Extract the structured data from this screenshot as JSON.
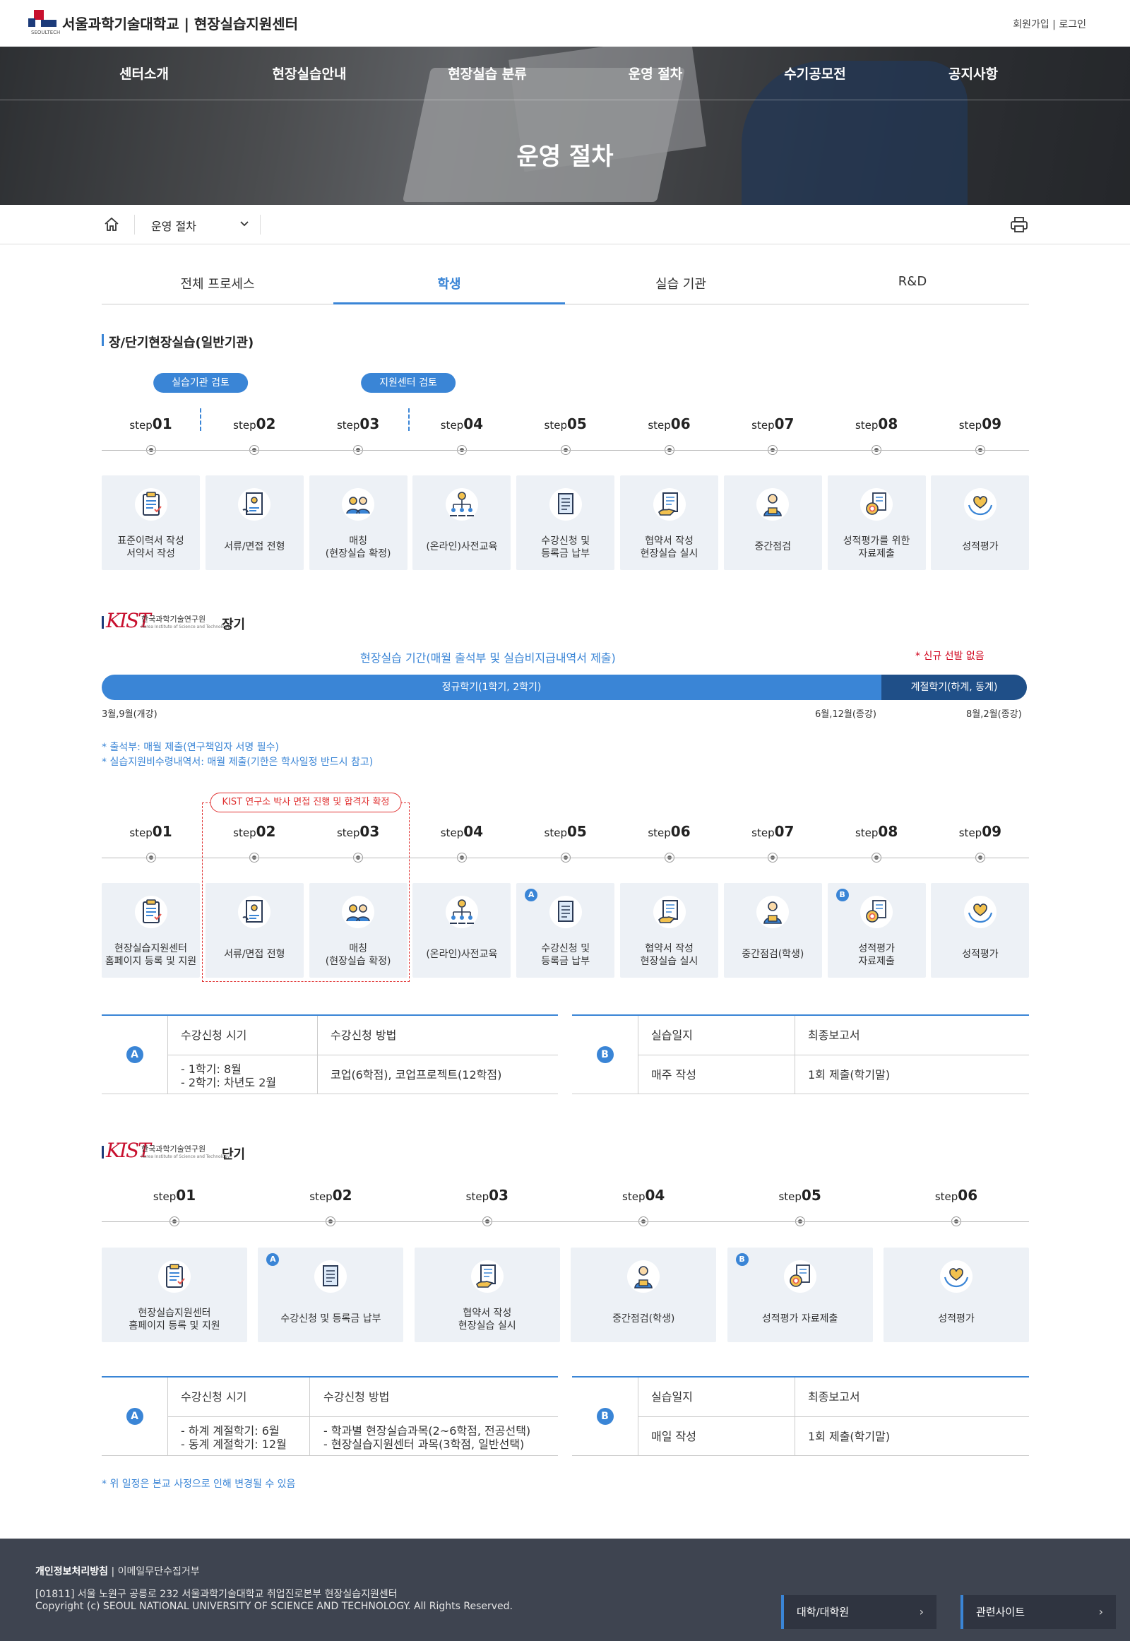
{
  "header": {
    "brand": "서울과학기술대학교 | 현장실습지원센터",
    "logo_sub": "SEOULTECH",
    "signup": "회원가입",
    "sep": " | ",
    "login": "로그인"
  },
  "nav": [
    "센터소개",
    "현장실습안내",
    "현장실습 분류",
    "운영 절차",
    "수기공모전",
    "공지사항"
  ],
  "hero_title": "운영 절차",
  "breadcrumb": {
    "selected": "운영 절차"
  },
  "tabs": [
    "전체 프로세스",
    "학생",
    "실습 기관",
    "R&D"
  ],
  "section1": {
    "title": "장/단기현장실습(일반기관)",
    "pill1": "실습기관 검토",
    "pill2": "지원센터 검토",
    "steps": [
      {
        "w": "step",
        "n": "01"
      },
      {
        "w": "step",
        "n": "02"
      },
      {
        "w": "step",
        "n": "03"
      },
      {
        "w": "step",
        "n": "04"
      },
      {
        "w": "step",
        "n": "05"
      },
      {
        "w": "step",
        "n": "06"
      },
      {
        "w": "step",
        "n": "07"
      },
      {
        "w": "step",
        "n": "08"
      },
      {
        "w": "step",
        "n": "09"
      }
    ],
    "cards": [
      [
        "표준이력서 작성",
        "서약서 작성"
      ],
      [
        "서류/면접 전형"
      ],
      [
        "매칭",
        "(현장실습 확정)"
      ],
      [
        "(온라인)사전교육"
      ],
      [
        "수강신청 및",
        "등록금 납부"
      ],
      [
        "협약서 작성",
        "현장실습 실시"
      ],
      [
        "중간점검"
      ],
      [
        "성적평가를 위한",
        "자료제출"
      ],
      [
        "성적평가"
      ]
    ]
  },
  "section2": {
    "kist_name": "한국과학기술연구원",
    "kist_eng": "Korea Institute of Science and Technology",
    "type": "장기",
    "period": "현장실습 기간(매월 출석부 및 실습비지급내역서 제출)",
    "no_select": "* 신규 선발 없음",
    "bar_regular": "정규학기(1학기, 2학기)",
    "bar_season": "계절학기(하계, 동계)",
    "date1": "3월,9월(개강)",
    "date2": "6월,12월(종강)",
    "date3": "8월,2월(종강)",
    "note1": "* 출석부: 매월 제출(연구책임자 서명 필수)",
    "note2": "* 실습지원비수령내역서: 매월 제출(기한은 학사일정 반드시 참고)",
    "red_pill": "KIST 연구소 박사 면접 진행 및 합격자 확정",
    "cards": [
      [
        "현장실습지원센터",
        "홈페이지 등록 및 지원"
      ],
      [
        "서류/면접 전형"
      ],
      [
        "매칭",
        "(현장실습 확정)"
      ],
      [
        "(온라인)사전교육"
      ],
      [
        "수강신청 및",
        "등록금 납부"
      ],
      [
        "협약서 작성",
        "현장실습 실시"
      ],
      [
        "중간점검(학생)"
      ],
      [
        "성적평가",
        "자료제출"
      ],
      [
        "성적평가"
      ]
    ],
    "badgeA": "A",
    "badgeB": "B",
    "tableA": {
      "h1": "수강신청 시기",
      "h2": "수강신청 방법",
      "v1a": "- 1학기: 8월",
      "v1b": "- 2학기: 차년도 2월",
      "v2": "코업(6학점), 코업프로젝트(12학점)"
    },
    "tableB": {
      "h1": "실습일지",
      "h2": "최종보고서",
      "v1": "매주 작성",
      "v2": "1회 제출(학기말)"
    }
  },
  "section3": {
    "type": "단기",
    "steps": [
      {
        "w": "step",
        "n": "01"
      },
      {
        "w": "step",
        "n": "02"
      },
      {
        "w": "step",
        "n": "03"
      },
      {
        "w": "step",
        "n": "04"
      },
      {
        "w": "step",
        "n": "05"
      },
      {
        "w": "step",
        "n": "06"
      }
    ],
    "cards": [
      [
        "현장실습지원센터",
        "홈페이지 등록 및 지원"
      ],
      [
        "수강신청 및 등록금 납부"
      ],
      [
        "협약서 작성",
        "현장실습 실시"
      ],
      [
        "중간점검(학생)"
      ],
      [
        "성적평가 자료제출"
      ],
      [
        "성적평가"
      ]
    ],
    "tableA": {
      "h1": "수강신청 시기",
      "h2": "수강신청 방법",
      "v1a": "- 하계 계절학기: 6월",
      "v1b": "- 동계 계절학기: 12월",
      "v2a": "- 학과별 현장실습과목(2~6학점, 전공선택)",
      "v2b": "- 현장실습지원센터 과목(3학점, 일반선택)"
    },
    "tableB": {
      "h1": "실습일지",
      "h2": "최종보고서",
      "v1": "매일 작성",
      "v2": "1회 제출(학기말)"
    },
    "footnote": "* 위 일정은 본교 사정으로 인해 변경될 수 있음"
  },
  "footer": {
    "privacy": "개인정보처리방침",
    "sep": " | ",
    "email": "이메일무단수집거부",
    "address": "[01811] 서울 노원구 공릉로 232 서울과학기술대학교 취업진로본부 현장실습지원센터",
    "copyright": "Copyright (c) SEOUL NATIONAL UNIVERSITY OF SCIENCE AND TECHNOLOGY. All Rights Reserved.",
    "btn1": "대학/대학원",
    "btn2": "관련사이트",
    "arrow": "›"
  },
  "colors": {
    "accent": "#3a85d6",
    "dark": "#1f4f88",
    "red": "#e03131",
    "footer": "#3e4450"
  }
}
